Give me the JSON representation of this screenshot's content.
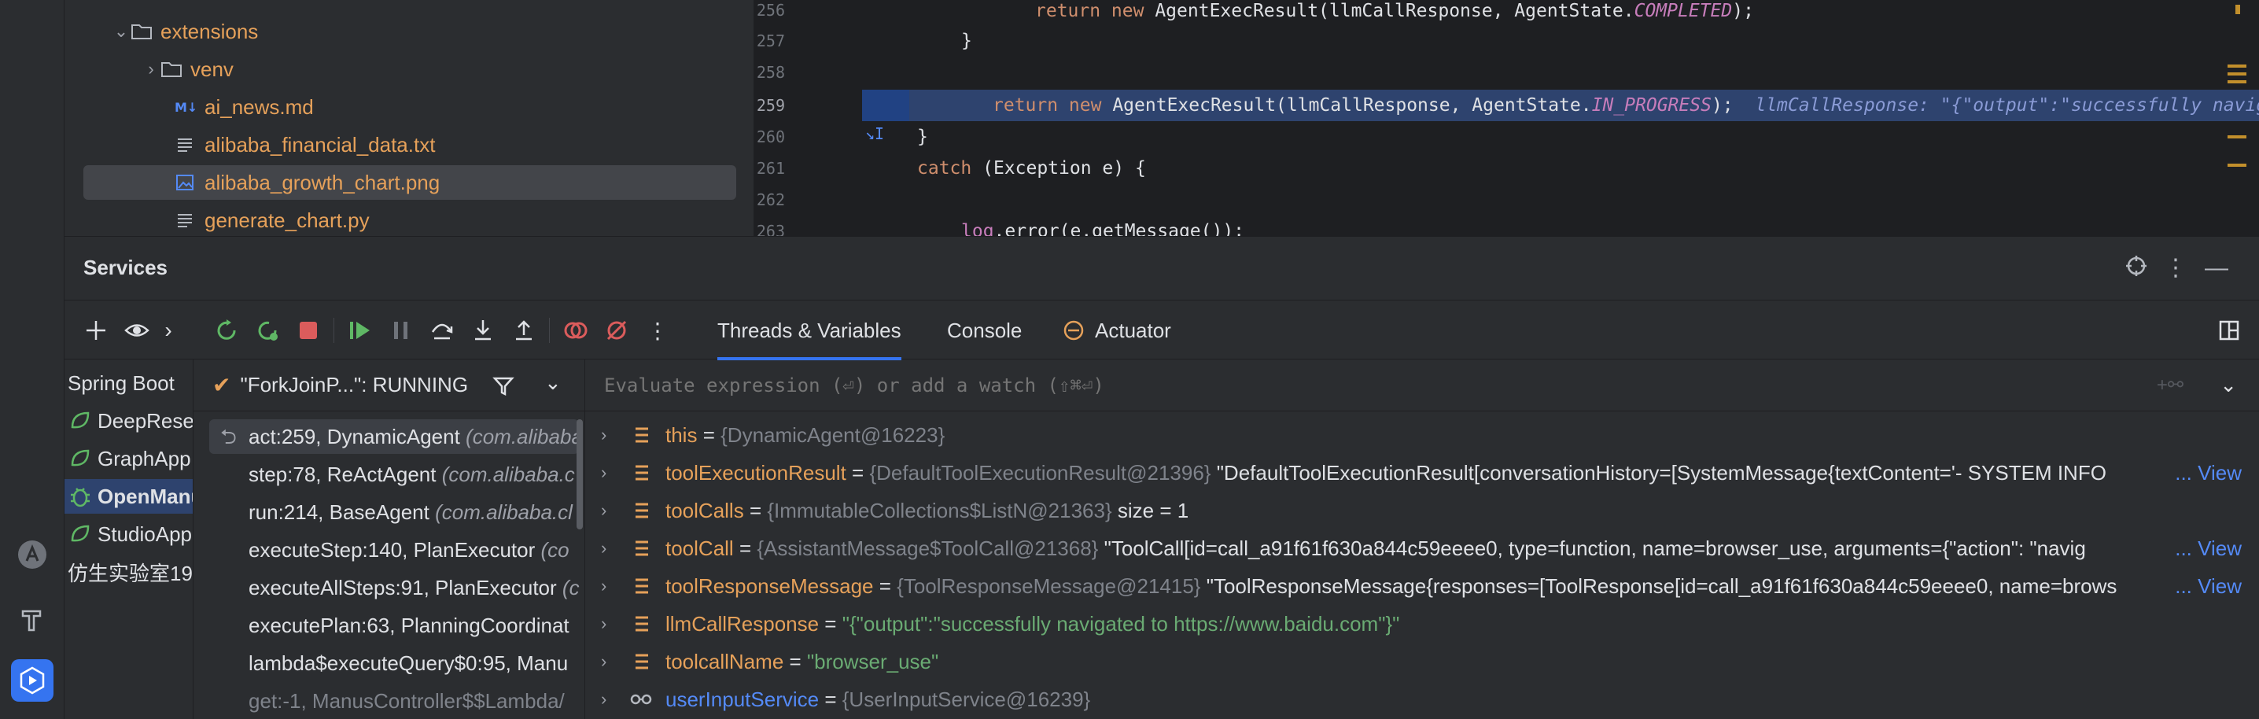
{
  "project_tree": {
    "items": [
      {
        "label": "extensions",
        "type": "folder",
        "expanded": true,
        "color": "orange"
      },
      {
        "label": "venv",
        "type": "folder",
        "expanded": false,
        "color": "orange"
      },
      {
        "label": "ai_news.md",
        "type": "markdown",
        "color": "orange"
      },
      {
        "label": "alibaba_financial_data.txt",
        "type": "text",
        "color": "orange"
      },
      {
        "label": "alibaba_growth_chart.png",
        "type": "image",
        "color": "orange",
        "selected": true
      },
      {
        "label": "generate_chart.py",
        "type": "text",
        "color": "orange"
      }
    ]
  },
  "editor": {
    "lines": [
      {
        "num": "256",
        "code_kw": "return new ",
        "code_cls": "AgentExecResult(llmCallResponse, AgentState.",
        "code_enum": "COMPLETED",
        "code_end": ");",
        "indent": 5
      },
      {
        "num": "257",
        "code_plain": "}",
        "indent": 4
      },
      {
        "num": "258",
        "code_plain": "",
        "indent": 0
      },
      {
        "num": "259",
        "code_kw": "return new ",
        "code_cls": "AgentExecResult(llmCallResponse, AgentState.",
        "code_enum": "IN_PROGRESS",
        "code_end": ");",
        "hint": "llmCallResponse: \"{\"output\":\"successfully navigated",
        "indent": 4,
        "current": true
      },
      {
        "num": "260",
        "code_plain": "}",
        "indent": 2
      },
      {
        "num": "261",
        "code_kw": "catch ",
        "code_cls": "(Exception e) {",
        "indent": 2
      },
      {
        "num": "262",
        "code_plain": "",
        "indent": 0
      },
      {
        "num": "263",
        "code_field": "log",
        "code_cls": ".error(e.getMessage());",
        "indent": 4
      }
    ]
  },
  "services": {
    "title": "Services",
    "tabs": [
      {
        "label": "Threads & Variables",
        "active": true
      },
      {
        "label": "Console",
        "active": false
      },
      {
        "label": "Actuator",
        "active": false
      }
    ],
    "tree": [
      {
        "label": "Spring Boot",
        "type": "group"
      },
      {
        "label": "DeepResearch",
        "type": "app"
      },
      {
        "label": "GraphApp",
        "type": "app"
      },
      {
        "label": "OpenManus",
        "type": "app-debug",
        "selected": true
      },
      {
        "label": "StudioApp",
        "type": "app"
      },
      {
        "label": "仿生实验室19",
        "type": "plain"
      }
    ],
    "thread": {
      "label": "\"ForkJoinP...\": RUNNING"
    },
    "frames": [
      {
        "method": "act:259, DynamicAgent",
        "pkg": "(com.alibaba",
        "selected": true
      },
      {
        "method": "step:78, ReActAgent",
        "pkg": "(com.alibaba.c"
      },
      {
        "method": "run:214, BaseAgent",
        "pkg": "(com.alibaba.cl"
      },
      {
        "method": "executeStep:140, PlanExecutor",
        "pkg": "(co"
      },
      {
        "method": "executeAllSteps:91, PlanExecutor",
        "pkg": "(c"
      },
      {
        "method": "executePlan:63, PlanningCoordinat",
        "pkg": ""
      },
      {
        "method": "lambda$executeQuery$0:95, Manu",
        "pkg": ""
      },
      {
        "method": "get:-1, ManusController$$Lambda/",
        "pkg": "",
        "dim": true
      }
    ],
    "eval_placeholder": "Evaluate expression (⏎) or add a watch (⇧⌘⏎)",
    "variables": [
      {
        "name": "this",
        "type": "{DynamicAgent@16223}",
        "value": "",
        "view": ""
      },
      {
        "name": "toolExecutionResult",
        "type": "{DefaultToolExecutionResult@21396}",
        "value": "\"DefaultToolExecutionResult[conversationHistory=[SystemMessage{textContent='- SYSTEM INFO",
        "view": "... View"
      },
      {
        "name": "toolCalls",
        "type": "{ImmutableCollections$ListN@21363}",
        "value": " size = 1",
        "view": ""
      },
      {
        "name": "toolCall",
        "type": "{AssistantMessage$ToolCall@21368}",
        "value": "\"ToolCall[id=call_a91f61f630a844c59eeee0, type=function, name=browser_use, arguments={\"action\": \"navig",
        "view": "... View"
      },
      {
        "name": "toolResponseMessage",
        "type": "{ToolResponseMessage@21415}",
        "value": "\"ToolResponseMessage{responses=[ToolResponse[id=call_a91f61f630a844c59eeee0, name=brows",
        "view": "... View"
      },
      {
        "name": "llmCallResponse",
        "type": "",
        "str": "\"{\"output\":\"successfully navigated to https://www.baidu.com\"}\"",
        "view": ""
      },
      {
        "name": "toolcallName",
        "type": "",
        "str": "\"browser_use\"",
        "view": ""
      },
      {
        "name": "userInputService",
        "type": "{UserInputService@16239}",
        "value": "",
        "view": "",
        "watch": true
      }
    ]
  }
}
